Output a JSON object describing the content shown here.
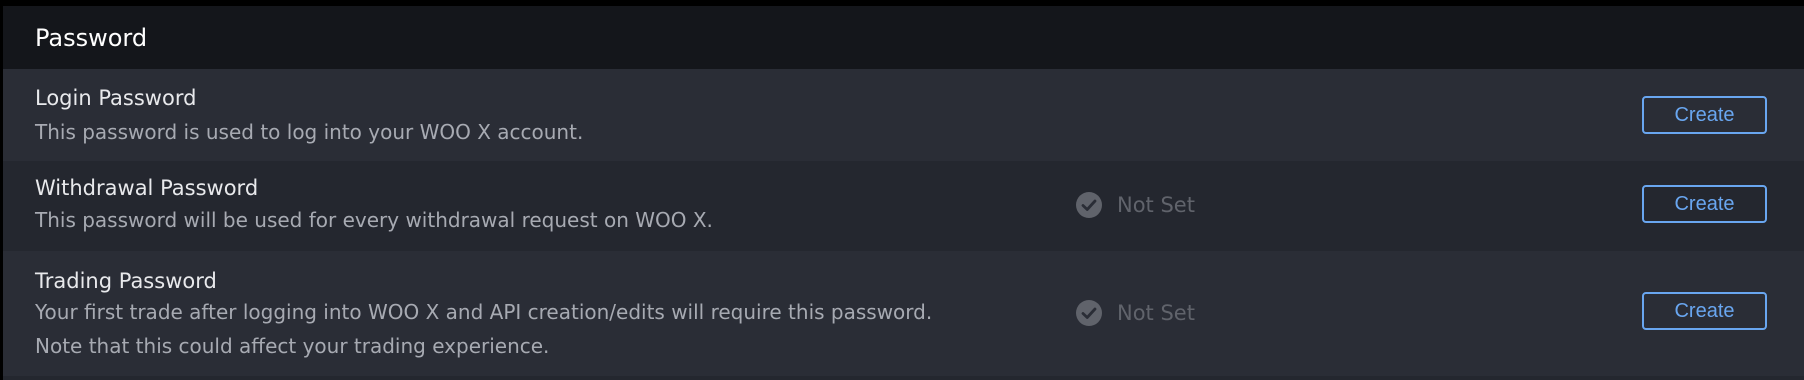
{
  "section": {
    "title": "Password"
  },
  "rows": [
    {
      "title": "Login Password",
      "description": "This password is used to log into your WOO X account.",
      "button_label": "Create"
    },
    {
      "title": "Withdrawal Password",
      "description": "This password will be used for every withdrawal request on WOO X.",
      "status": "Not Set",
      "button_label": "Create"
    },
    {
      "title": "Trading Password",
      "description": "Your first trade after logging into WOO X and API creation/edits will require this password. Note that this could affect your trading experience.",
      "status": "Not Set",
      "button_label": "Create"
    }
  ],
  "colors": {
    "accent": "#69a6f0",
    "status_inactive": "#60636b"
  },
  "icons": {
    "status": "check-circle-icon"
  }
}
